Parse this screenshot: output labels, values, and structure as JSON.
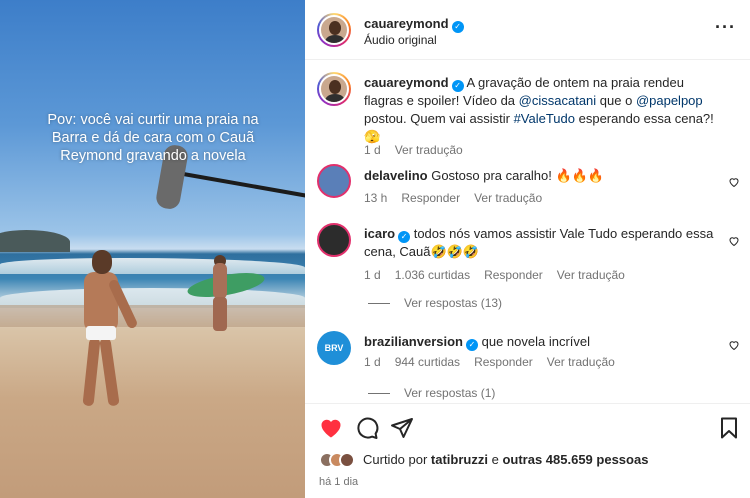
{
  "media": {
    "overlay_text": "Pov: você vai curtir uma praia na Barra e dá de cara com o Cauã Reymond gravando a novela"
  },
  "header": {
    "username": "cauareymond",
    "audio_label": "Áudio original"
  },
  "caption": {
    "username": "cauareymond",
    "text_1": " A gravação de ontem na praia rendeu flagras e spoiler! Vídeo da ",
    "mention_1": "@cissacatani",
    "text_2": " que o ",
    "mention_2": "@papelpop",
    "text_3": " postou. Quem vai assistir ",
    "hashtag": "#ValeTudo",
    "text_4": " esperando essa cena?! 🫣",
    "time": "1 d",
    "translate": "Ver tradução"
  },
  "comments": [
    {
      "username": "delavelino",
      "text": "Gostoso pra caralho! 🔥🔥🔥",
      "time": "13 h",
      "reply": "Responder",
      "translate": "Ver tradução"
    },
    {
      "username": "icaro",
      "text": "todos nós vamos assistir Vale Tudo esperando essa cena, Cauã🤣🤣🤣",
      "time": "1 d",
      "likes": "1.036 curtidas",
      "reply": "Responder",
      "translate": "Ver tradução",
      "view_replies": "Ver respostas (13)"
    },
    {
      "username": "brazilianversion",
      "text": "que novela incrível",
      "avatar_text": "BRV",
      "time": "1 d",
      "likes": "944 curtidas",
      "reply": "Responder",
      "translate": "Ver tradução",
      "view_replies": "Ver respostas (1)"
    }
  ],
  "footer": {
    "liked_prefix": "Curtido por ",
    "liked_user": "tatibruzzi",
    "liked_mid": " e ",
    "liked_count": "outras 485.659 pessoas",
    "time": "há 1 dia"
  },
  "colors": {
    "like_red": "#ff3040",
    "verified_blue": "#0095f6",
    "mention_blue": "#00376b",
    "muted_gray": "#737373"
  }
}
